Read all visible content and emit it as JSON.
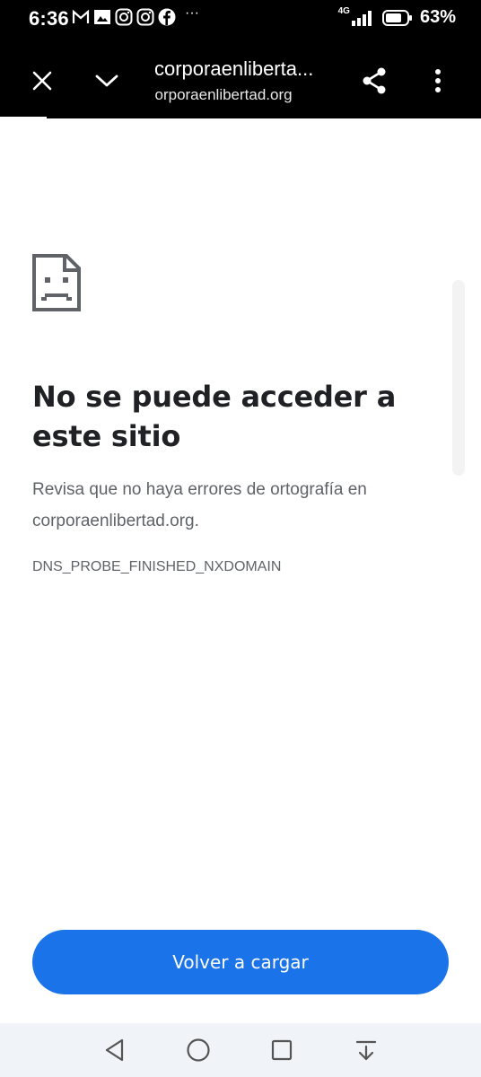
{
  "status_bar": {
    "time": "6:36",
    "notification_icons": [
      "gmail-icon",
      "gallery-icon",
      "instagram-icon",
      "instagram-icon",
      "facebook-icon"
    ],
    "more_indicator": "···",
    "network_label": "4G",
    "battery_percent": "63%"
  },
  "toolbar": {
    "title": "corporaenliberta...",
    "url": "corporaenlibertad.org"
  },
  "error_page": {
    "title": "No se puede acceder a este sitio",
    "body_text": "Revisa que no haya errores de ortografía en",
    "body_domain": "corporaenlibertad.org.",
    "error_code": "DNS_PROBE_FINISHED_NXDOMAIN",
    "reload_label": "Volver a cargar"
  },
  "colors": {
    "toolbar_bg": "#000000",
    "primary_button": "#1a73e8",
    "title_text": "#202124",
    "secondary_text": "#5f6368",
    "navbar_bg": "#f0f4f8"
  }
}
